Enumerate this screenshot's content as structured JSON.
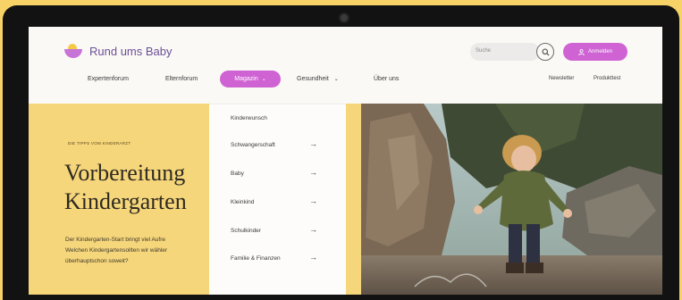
{
  "brand": {
    "name": "Rund ums Baby"
  },
  "header": {
    "search_placeholder": "Suche",
    "login_label": "Anmelden",
    "nav": [
      {
        "label": "Expertenforum"
      },
      {
        "label": "Elternforum"
      },
      {
        "label": "Magazin",
        "active": true
      },
      {
        "label": "Gesundheit"
      },
      {
        "label": "Über uns"
      }
    ],
    "secondary_nav": [
      {
        "label": "Newsletter"
      },
      {
        "label": "Produkttest"
      }
    ]
  },
  "dropdown": {
    "items": [
      {
        "label": "Kinderwunsch",
        "has_arrow": false
      },
      {
        "label": "Schwangerschaft",
        "has_arrow": true
      },
      {
        "label": "Baby",
        "has_arrow": true
      },
      {
        "label": "Kleinkind",
        "has_arrow": true
      },
      {
        "label": "Schulkinder",
        "has_arrow": true
      },
      {
        "label": "Familie & Finanzen",
        "has_arrow": true
      }
    ]
  },
  "hero": {
    "tagline": "DIE TIPPS VOM KINDERARZT",
    "headline_line1": "Vorbereitung",
    "headline_line2": "Kindergarten",
    "intro_line1": "Der Kindergarten-Start bringt viel Aufre",
    "intro_line2": "Welchen Kindergartensollten wir wähler",
    "intro_line3": "überhauptschon soweit?"
  },
  "colors": {
    "background": "#f6d267",
    "accent": "#cf63d3",
    "hero_panel": "#f6d67a",
    "brand_text": "#6b4f97"
  }
}
